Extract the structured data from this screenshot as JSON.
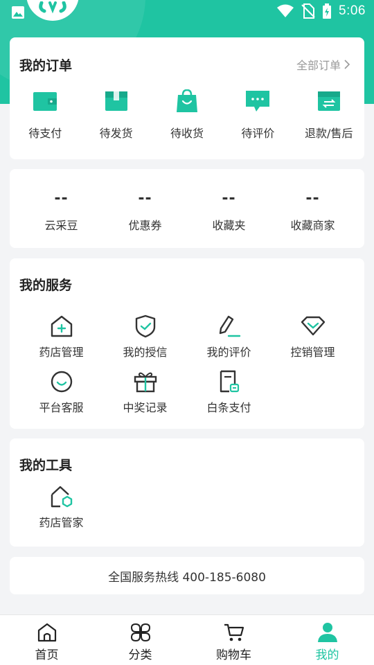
{
  "status_bar": {
    "time": "5:06"
  },
  "colors": {
    "accent": "#1fc4a2",
    "text": "#222222",
    "muted": "#999999",
    "background": "#f3f4f6"
  },
  "orders": {
    "title": "我的订单",
    "all_label": "全部订单",
    "items": [
      {
        "label": "待支付",
        "icon": "wallet-icon"
      },
      {
        "label": "待发货",
        "icon": "package-icon"
      },
      {
        "label": "待收货",
        "icon": "shopping-bag-icon"
      },
      {
        "label": "待评价",
        "icon": "comment-icon"
      },
      {
        "label": "退款/售后",
        "icon": "refund-icon"
      }
    ]
  },
  "stats": [
    {
      "value": "--",
      "label": "云采豆"
    },
    {
      "value": "--",
      "label": "优惠券"
    },
    {
      "value": "--",
      "label": "收藏夹"
    },
    {
      "value": "--",
      "label": "收藏商家"
    }
  ],
  "services": {
    "title": "我的服务",
    "items": [
      {
        "label": "药店管理",
        "icon": "pharmacy-icon"
      },
      {
        "label": "我的授信",
        "icon": "shield-check-icon"
      },
      {
        "label": "我的评价",
        "icon": "pen-icon"
      },
      {
        "label": "控销管理",
        "icon": "diamond-icon"
      },
      {
        "label": "平台客服",
        "icon": "customer-service-icon"
      },
      {
        "label": "中奖记录",
        "icon": "gift-icon"
      },
      {
        "label": "白条支付",
        "icon": "bill-icon"
      }
    ]
  },
  "tools": {
    "title": "我的工具",
    "items": [
      {
        "label": "药店管家",
        "icon": "store-settings-icon"
      }
    ]
  },
  "hotline": {
    "text": "全国服务热线 400-185-6080"
  },
  "tabbar": {
    "tabs": [
      {
        "label": "首页",
        "icon": "home-icon"
      },
      {
        "label": "分类",
        "icon": "category-icon"
      },
      {
        "label": "购物车",
        "icon": "cart-icon"
      },
      {
        "label": "我的",
        "icon": "user-icon",
        "active": true
      }
    ]
  }
}
